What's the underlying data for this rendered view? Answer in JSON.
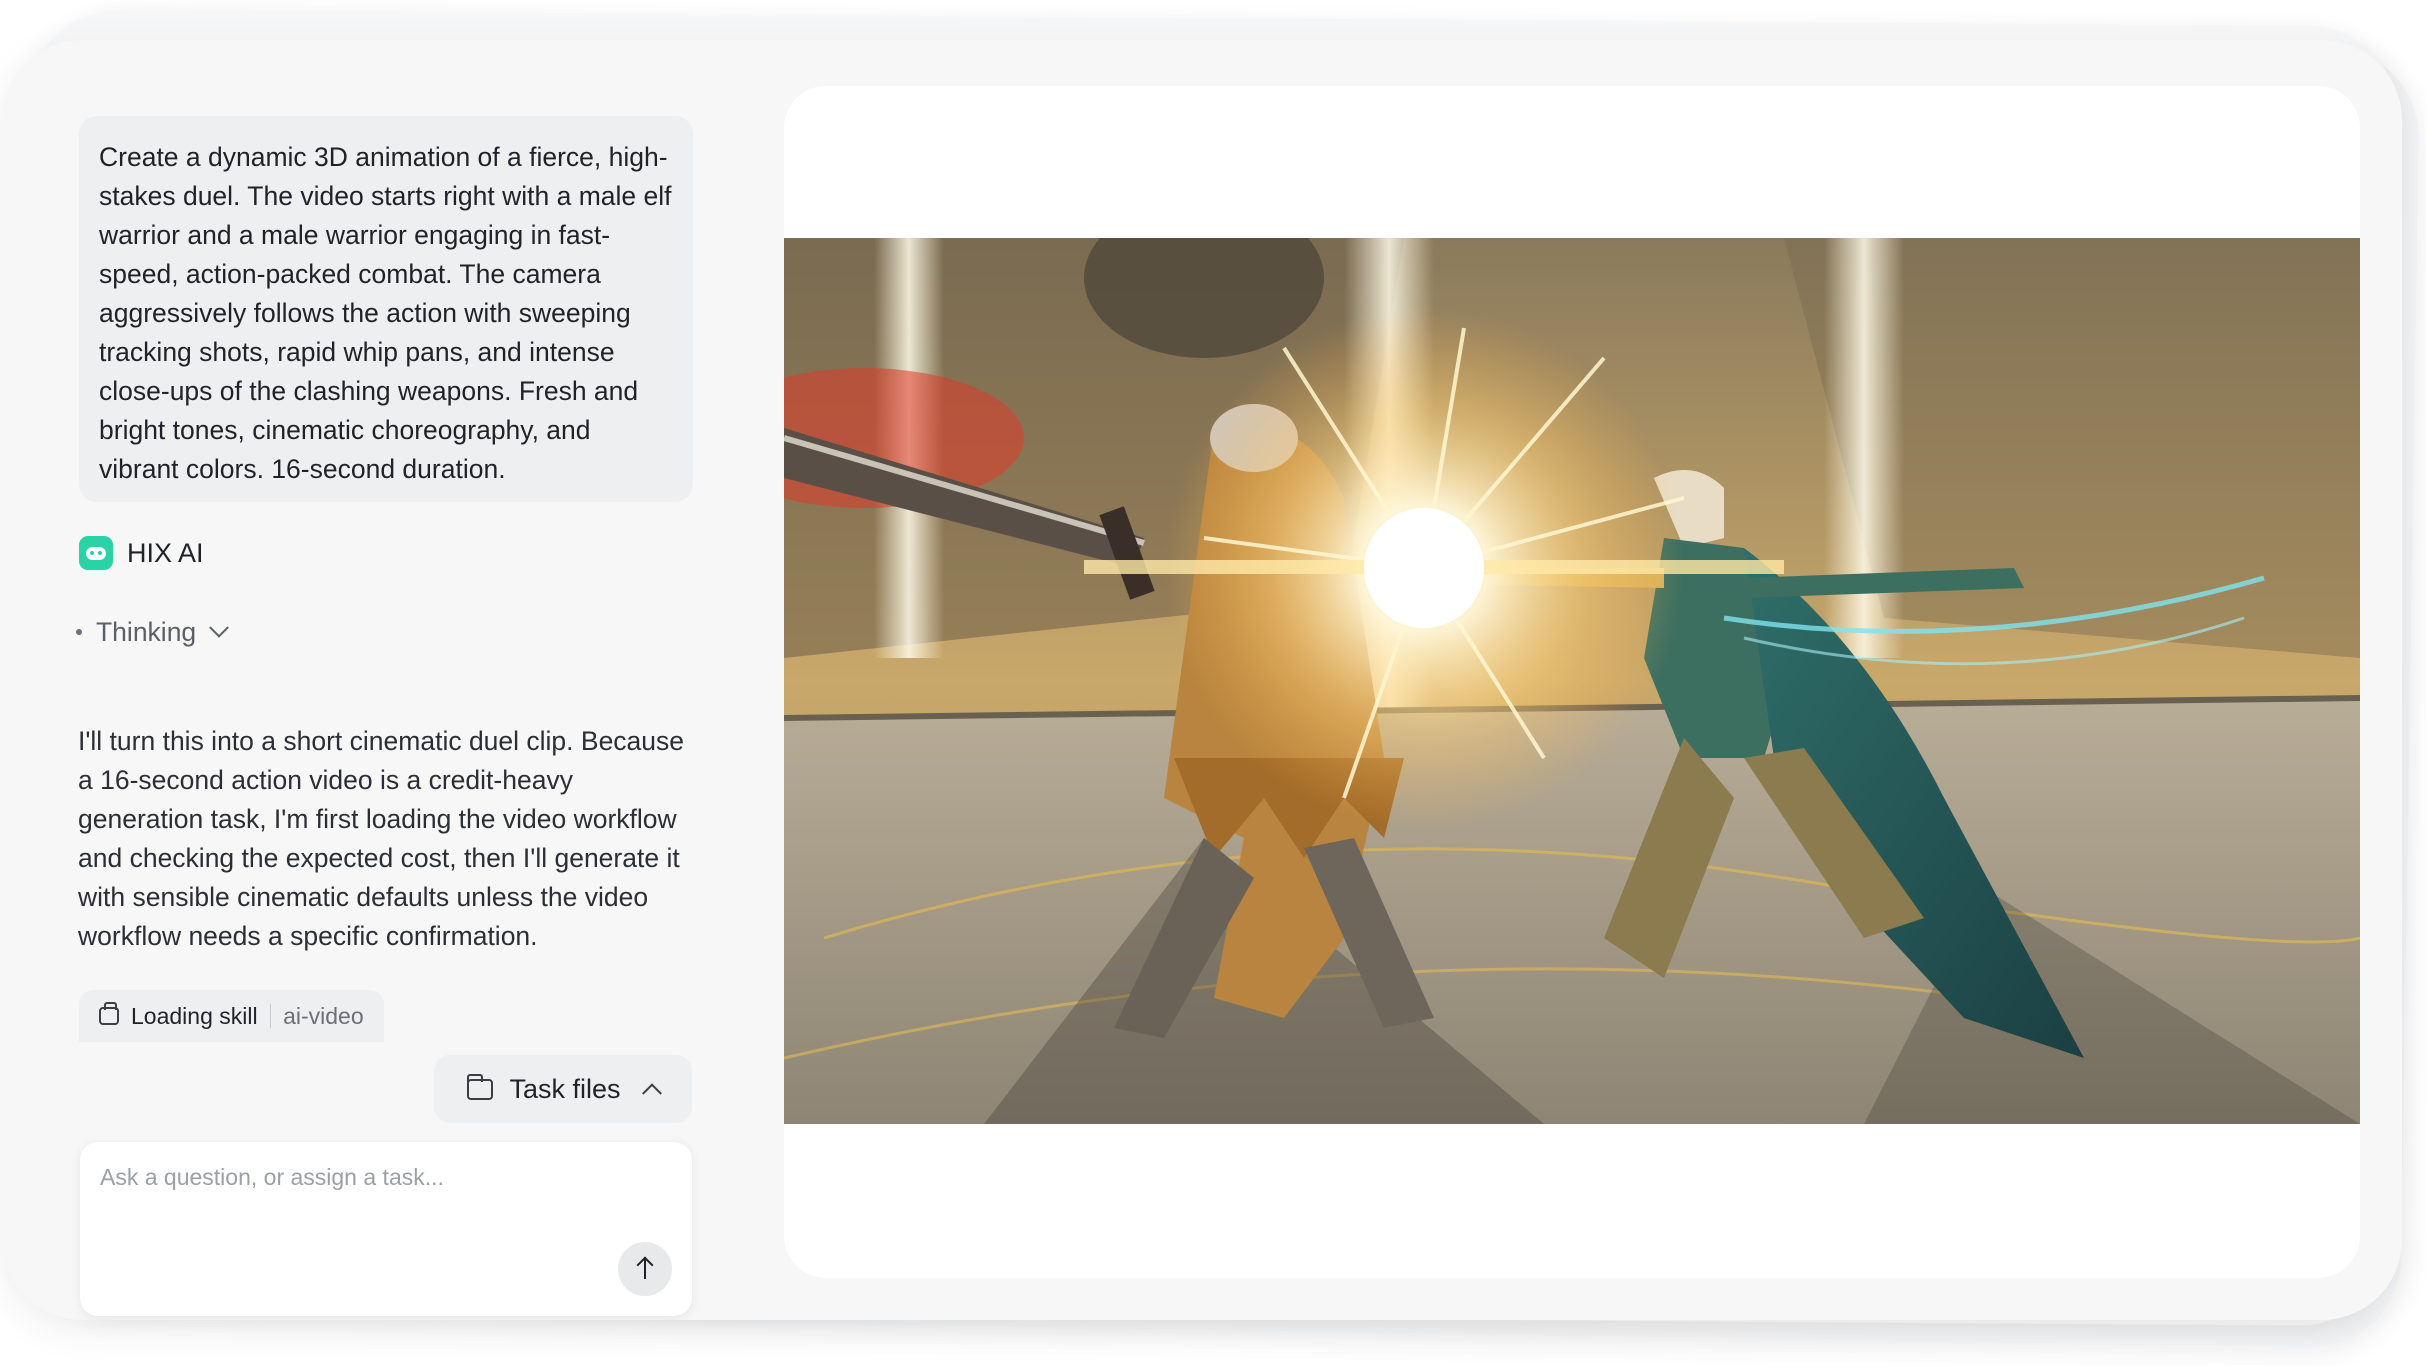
{
  "chat": {
    "user_message": "Create a dynamic 3D animation of a fierce, high-stakes duel. The video starts right with a male elf warrior and a male warrior engaging in fast-speed, action-packed combat. The camera aggressively follows the action with sweeping tracking shots, rapid whip pans, and intense close-ups of the clashing weapons. Fresh and bright tones, cinematic choreography, and vibrant colors. 16-second duration.",
    "agent": {
      "name": "HIX AI",
      "logo_icon": "robot-icon",
      "logo_color": "#2ad3a6"
    },
    "thinking_label": "Thinking",
    "response_text": "I'll turn this into a short cinematic duel clip. Because a 16-second action video is a credit-heavy generation task, I'm first loading the video workflow and checking the expected cost, then I'll generate it with sensible cinematic defaults unless the video workflow needs a specific confirmation.",
    "skill": {
      "status": "Loading skill",
      "name": "ai-video",
      "icon": "box-icon"
    },
    "task_files_label": "Task files",
    "composer": {
      "placeholder": "Ask a question, or assign a task..."
    }
  },
  "preview": {
    "media": "video-frame-duel"
  }
}
